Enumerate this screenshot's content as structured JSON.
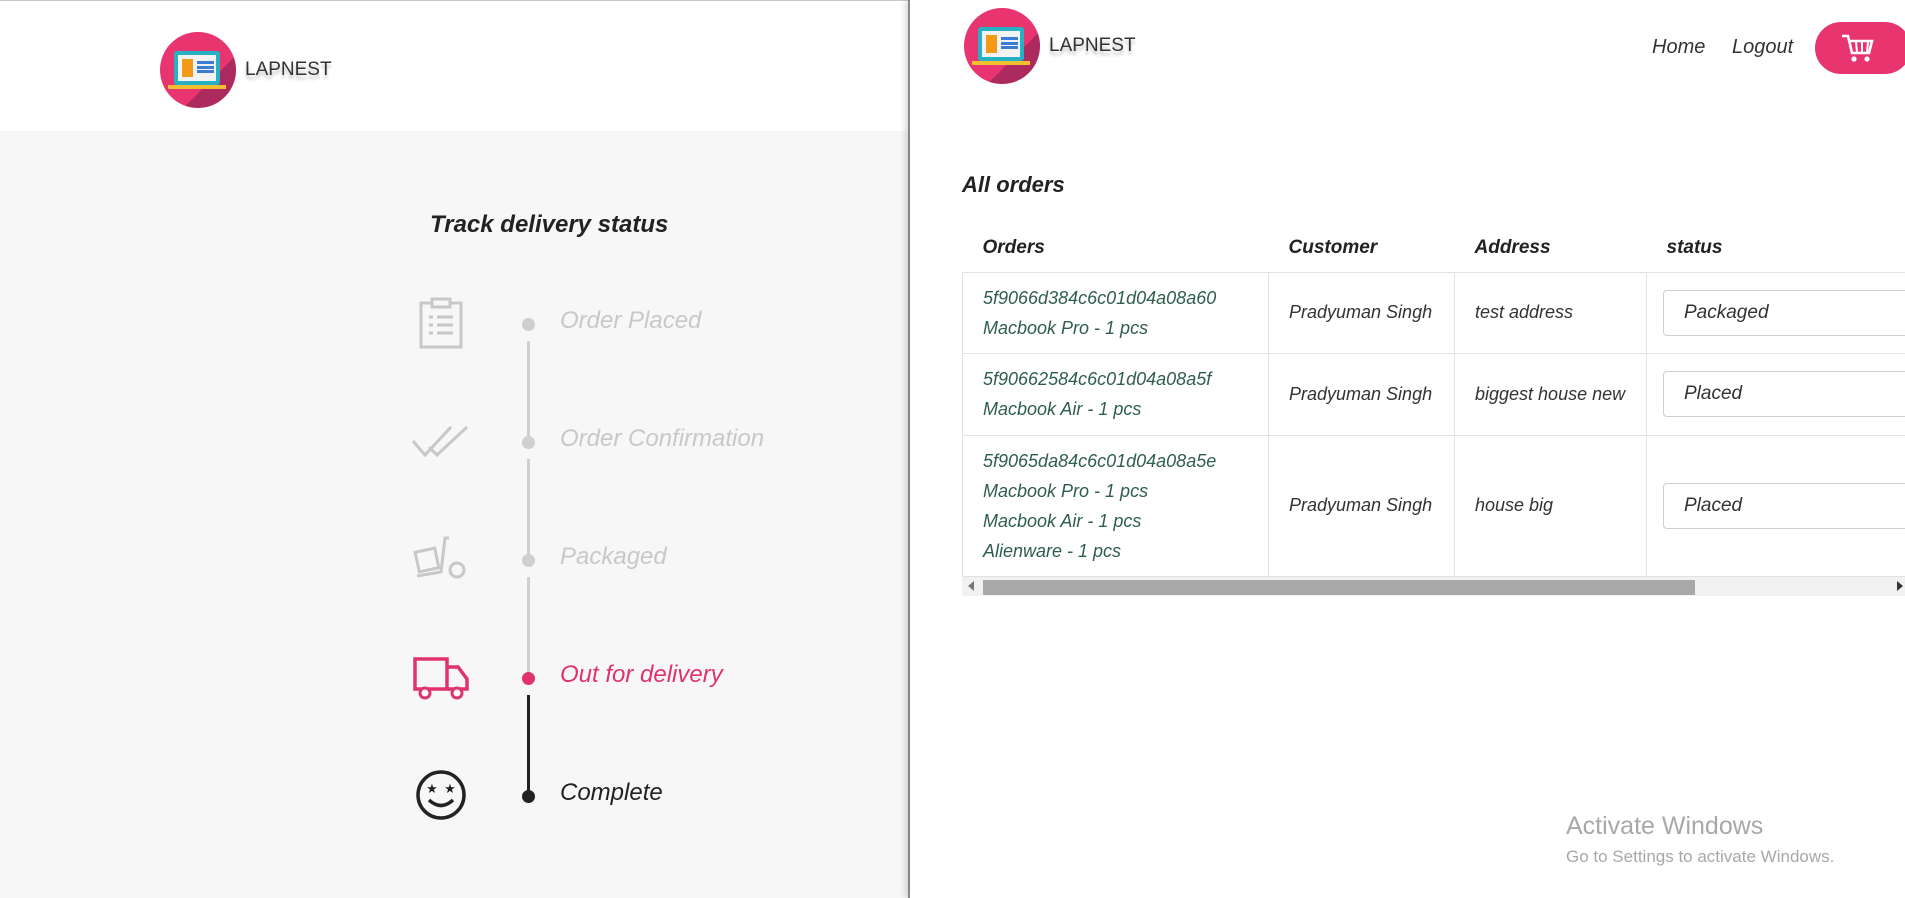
{
  "brand": {
    "name": "LAPNEST",
    "accent": "#e8346f"
  },
  "tracker": {
    "title": "Track delivery status",
    "steps": [
      {
        "label": "Order Placed",
        "icon": "clipboard-icon",
        "state": "inactive"
      },
      {
        "label": "Order Confirmation",
        "icon": "double-check-icon",
        "state": "inactive"
      },
      {
        "label": "Packaged",
        "icon": "hand-truck-icon",
        "state": "inactive"
      },
      {
        "label": "Out for delivery",
        "icon": "delivery-truck-icon",
        "state": "active"
      },
      {
        "label": "Complete",
        "icon": "smiley-icon",
        "state": "complete"
      }
    ],
    "colors": {
      "inactive": "#c8c8c8",
      "active": "#e0326d",
      "complete": "#222222"
    }
  },
  "nav": {
    "home": "Home",
    "logout": "Logout",
    "cart_icon": "cart-icon"
  },
  "orders": {
    "title": "All orders",
    "columns": [
      "Orders",
      "Customer",
      "Address",
      "status"
    ],
    "rows": [
      {
        "id": "5f9066d384c6c01d04a08a60",
        "items": [
          "Macbook Pro - 1 pcs"
        ],
        "customer": "Pradyuman Singh",
        "address": "test address",
        "status": "Packaged"
      },
      {
        "id": "5f90662584c6c01d04a08a5f",
        "items": [
          "Macbook Air - 1 pcs"
        ],
        "customer": "Pradyuman Singh",
        "address": "biggest house new",
        "status": "Placed"
      },
      {
        "id": "5f9065da84c6c01d04a08a5e",
        "items": [
          "Macbook Pro - 1 pcs",
          "Macbook Air - 1 pcs",
          "Alienware - 1 pcs"
        ],
        "customer": "Pradyuman Singh",
        "address": "house big",
        "status": "Placed"
      }
    ]
  },
  "watermark": {
    "line1": "Activate Windows",
    "line2": "Go to Settings to activate Windows."
  }
}
